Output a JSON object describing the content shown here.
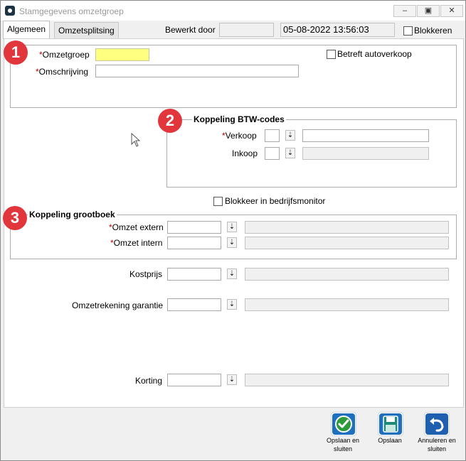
{
  "window": {
    "title": "Stamgegevens omzetgroep",
    "minimize_icon": "minimize-icon",
    "maximize_icon": "maximize-icon",
    "close_icon": "close-icon"
  },
  "tabs": [
    {
      "label": "Algemeen",
      "active": true
    },
    {
      "label": "Omzetsplitsing",
      "active": false
    }
  ],
  "header": {
    "bewerkt_door_label": "Bewerkt door",
    "bewerkt_door_value": "",
    "date": "05-08-2022 13:56:03",
    "blokkeren_label": "Blokkeren"
  },
  "general": {
    "omzetgroep_label": "Omzetgroep",
    "omzetgroep_value": "",
    "omschrijving_label": "Omschrijving",
    "omschrijving_value": "",
    "autoverkoop_label": "Betreft autoverkoop"
  },
  "btw": {
    "legend": "Koppeling BTW-codes",
    "verkoop_label": "Verkoop",
    "inkoop_label": "Inkoop"
  },
  "monitor_label": "Blokkeer in bedrijfsmonitor",
  "grootboek": {
    "legend": "Koppeling grootboek",
    "omzet_extern_label": "Omzet extern",
    "omzet_intern_label": "Omzet intern"
  },
  "kostprijs_label": "Kostprijs",
  "garantie_label": "Omzetrekening garantie",
  "korting_label": "Korting",
  "required_mark": "*",
  "dropdown_glyph": "⇣",
  "badges": [
    "1",
    "2",
    "3"
  ],
  "footer": {
    "save_close_label": "Opslaan en sluiten",
    "save_label": "Opslaan",
    "cancel_label": "Annuleren en sluiten"
  },
  "colors": {
    "required": "#c00000",
    "badge": "#e1373c",
    "highlight": "#ffff80",
    "save_close": "#2e9a3a",
    "save": "#1f8a7a",
    "cancel": "#1f5fb0"
  }
}
